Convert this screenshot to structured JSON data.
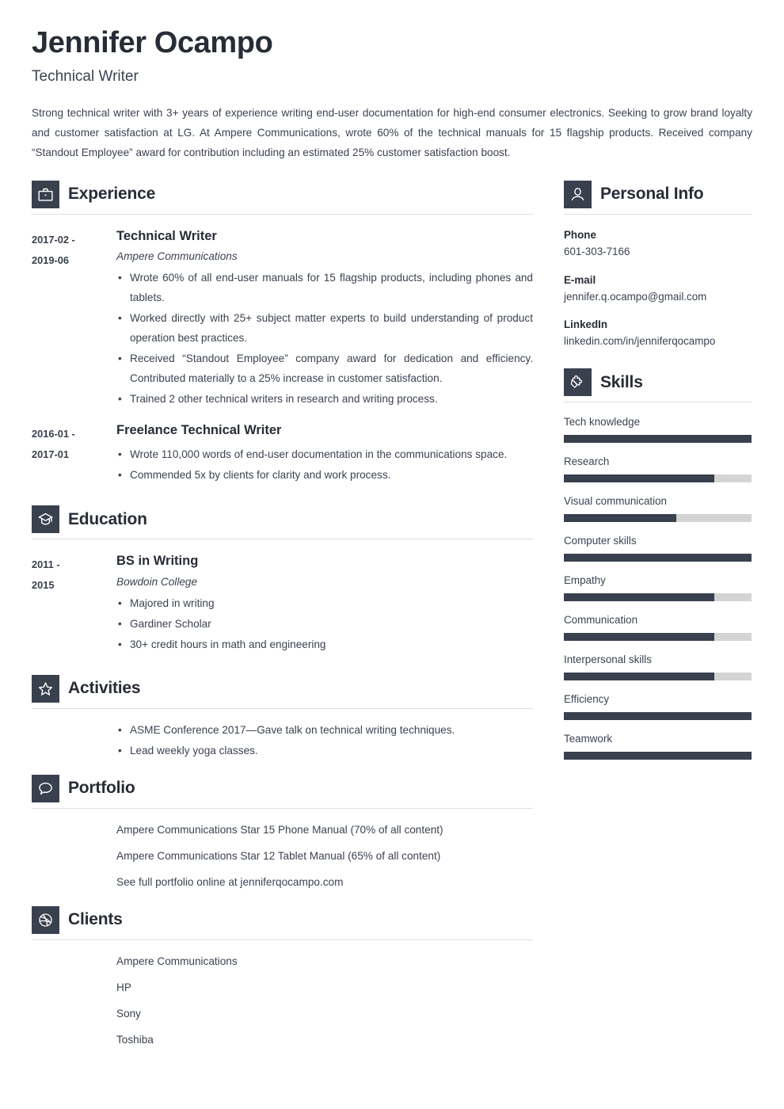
{
  "header": {
    "name": "Jennifer Ocampo",
    "job_title": "Technical Writer",
    "summary": "Strong technical writer with 3+ years of experience writing end-user documentation for high-end consumer electronics. Seeking to grow brand loyalty and customer satisfaction at LG. At Ampere Communications, wrote 60% of the technical manuals for 15 flagship products. Received company “Standout Employee” award for contribution including an estimated 25% customer satisfaction boost."
  },
  "theme": {
    "accent_dark": "#39404e",
    "heading_color": "#272c36",
    "body_color": "#3b4251",
    "track_gray": "#d4d4d4",
    "rule_gray": "#dedede"
  },
  "sections": {
    "experience": {
      "title": "Experience",
      "icon": "briefcase-icon",
      "entries": [
        {
          "dates": "2017-02 - 2019-06",
          "date_line_1": "2017-02 -",
          "date_line_2": "2019-06",
          "role": "Technical Writer",
          "organization": "Ampere Communications",
          "bullets": [
            "Wrote 60% of all end-user manuals for 15 flagship products, including phones and tablets.",
            "Worked directly with 25+ subject matter experts to build understanding of product operation best practices.",
            "Received “Standout Employee” company award for dedication and efficiency. Contributed materially to a 25% increase in customer satisfaction.",
            "Trained 2 other technical writers in research and writing process."
          ]
        },
        {
          "dates": "2016-01 - 2017-01",
          "date_line_1": "2016-01 -",
          "date_line_2": "2017-01",
          "role": "Freelance Technical Writer",
          "organization": "",
          "bullets": [
            "Wrote 110,000 words of end-user documentation in the communications space.",
            "Commended 5x by clients for clarity and work process."
          ]
        }
      ]
    },
    "education": {
      "title": "Education",
      "icon": "graduation-cap-icon",
      "entries": [
        {
          "dates": "2011 - 2015",
          "date_line_1": "2011 -",
          "date_line_2": "2015",
          "role": "BS in Writing",
          "organization": "Bowdoin College",
          "bullets": [
            "Majored in writing",
            "Gardiner Scholar",
            "30+ credit hours in math and engineering"
          ]
        }
      ]
    },
    "activities": {
      "title": "Activities",
      "icon": "star-icon",
      "bullets": [
        "ASME Conference 2017—Gave talk on technical writing techniques.",
        "Lead weekly yoga classes."
      ]
    },
    "portfolio": {
      "title": "Portfolio",
      "icon": "speech-bubble-icon",
      "items": [
        "Ampere Communications Star 15 Phone Manual (70% of all content)",
        "Ampere Communications Star 12 Tablet Manual (65% of all content)",
        "See full portfolio online at jenniferqocampo.com"
      ]
    },
    "clients": {
      "title": "Clients",
      "icon": "dribbble-ball-icon",
      "items": [
        "Ampere Communications",
        "HP",
        "Sony",
        "Toshiba"
      ]
    },
    "personal_info": {
      "title": "Personal Info",
      "icon": "person-icon",
      "fields": [
        {
          "label": "Phone",
          "value": "601-303-7166"
        },
        {
          "label": "E-mail",
          "value": "jennifer.q.ocampo@gmail.com"
        },
        {
          "label": "LinkedIn",
          "value": "linkedin.com/in/jenniferqocampo"
        }
      ]
    },
    "skills": {
      "title": "Skills",
      "icon": "puzzle-piece-icon",
      "items": [
        {
          "label": "Tech knowledge",
          "level": 100
        },
        {
          "label": "Research",
          "level": 80
        },
        {
          "label": "Visual communication",
          "level": 60
        },
        {
          "label": "Computer skills",
          "level": 100
        },
        {
          "label": "Empathy",
          "level": 80
        },
        {
          "label": "Communication",
          "level": 80
        },
        {
          "label": "Interpersonal skills",
          "level": 80
        },
        {
          "label": "Efficiency",
          "level": 100
        },
        {
          "label": "Teamwork",
          "level": 100
        }
      ]
    }
  }
}
